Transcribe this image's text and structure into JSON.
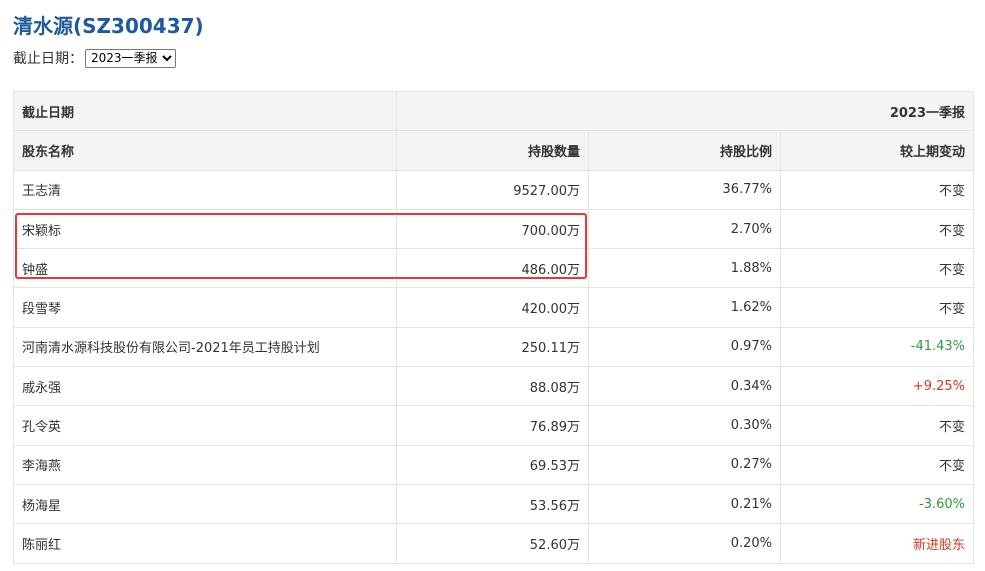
{
  "page": {
    "title": "清水源(SZ300437)",
    "date_label": "截止日期：",
    "date_select": {
      "selected": "2023一季报"
    }
  },
  "table": {
    "period_header": {
      "label": "截止日期",
      "value": "2023一季报"
    },
    "columns": [
      "股东名称",
      "持股数量",
      "持股比例",
      "较上期变动"
    ],
    "rows": [
      {
        "name": "王志清",
        "shares": "9527.00万",
        "ratio": "36.77%",
        "change": "不变",
        "tone": "neu"
      },
      {
        "name": "宋颖标",
        "shares": "700.00万",
        "ratio": "2.70%",
        "change": "不变",
        "tone": "neu"
      },
      {
        "name": "钟盛",
        "shares": "486.00万",
        "ratio": "1.88%",
        "change": "不变",
        "tone": "neu"
      },
      {
        "name": "段雪琴",
        "shares": "420.00万",
        "ratio": "1.62%",
        "change": "不变",
        "tone": "neu"
      },
      {
        "name": "河南清水源科技股份有限公司-2021年员工持股计划",
        "shares": "250.11万",
        "ratio": "0.97%",
        "change": "-41.43%",
        "tone": "neg"
      },
      {
        "name": "戚永强",
        "shares": "88.08万",
        "ratio": "0.34%",
        "change": "+9.25%",
        "tone": "pos"
      },
      {
        "name": "孔令英",
        "shares": "76.89万",
        "ratio": "0.30%",
        "change": "不变",
        "tone": "neu"
      },
      {
        "name": "李海燕",
        "shares": "69.53万",
        "ratio": "0.27%",
        "change": "不变",
        "tone": "neu"
      },
      {
        "name": "杨海星",
        "shares": "53.56万",
        "ratio": "0.21%",
        "change": "-3.60%",
        "tone": "neg"
      },
      {
        "name": "陈丽红",
        "shares": "52.60万",
        "ratio": "0.20%",
        "change": "新进股东",
        "tone": "new"
      }
    ]
  },
  "colors": {
    "title": "#1f5a9c",
    "header_bg": "#f4f4f4",
    "increase": "#d9381e",
    "decrease": "#2e9b3a",
    "highlight_box": "#e53935"
  }
}
